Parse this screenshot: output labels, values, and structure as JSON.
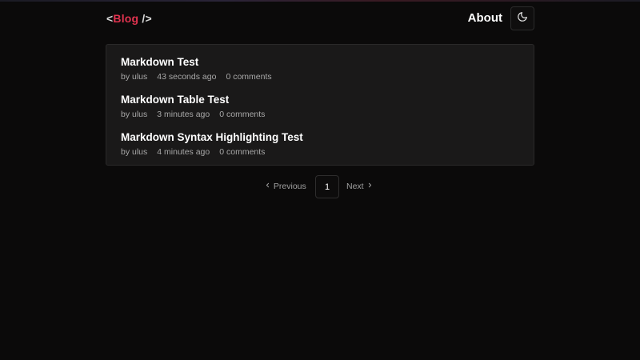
{
  "header": {
    "logo_open": "<",
    "logo_name": "Blog",
    "logo_close": " />",
    "about_label": "About",
    "theme_icon": "moon-icon"
  },
  "posts": [
    {
      "title": "Markdown Test",
      "author": "by ulus",
      "time": "43 seconds ago",
      "comments": "0 comments"
    },
    {
      "title": "Markdown Table Test",
      "author": "by ulus",
      "time": "3 minutes ago",
      "comments": "0 comments"
    },
    {
      "title": "Markdown Syntax Highlighting Test",
      "author": "by ulus",
      "time": "4 minutes ago",
      "comments": "0 comments"
    }
  ],
  "pagination": {
    "previous_label": "Previous",
    "current_page": "1",
    "next_label": "Next"
  },
  "colors": {
    "background": "#0b0a0a",
    "card": "#1a1919",
    "accent": "#e0334f",
    "muted_text": "#a8a8a8"
  }
}
